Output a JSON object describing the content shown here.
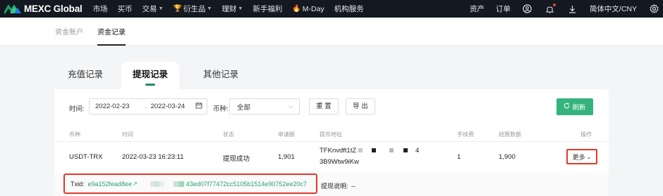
{
  "app": {
    "brand": "MEXC Global"
  },
  "topnav": {
    "items": [
      {
        "label": "市场",
        "caret": false
      },
      {
        "label": "买币",
        "caret": false
      },
      {
        "label": "交易",
        "caret": true
      },
      {
        "label": "衍生品",
        "caret": true
      },
      {
        "label": "理财",
        "caret": true
      },
      {
        "label": "新手福利",
        "caret": false
      },
      {
        "label": "M-Day",
        "caret": false
      },
      {
        "label": "机构服务",
        "caret": false
      }
    ],
    "assets": "资产",
    "orders": "订单",
    "language": "简体中文/CNY",
    "icons": [
      "trophy-icon",
      "flame-icon",
      "user-icon",
      "bell-icon",
      "download-icon",
      "gear-icon"
    ]
  },
  "subnav": {
    "tabs": [
      "资金账户",
      "资金记录"
    ],
    "active": 1
  },
  "tabs": {
    "items": [
      "充值记录",
      "提现记录",
      "其他记录"
    ],
    "active": 1
  },
  "filters": {
    "time_label": "时间:",
    "start_date": "2022-02-23",
    "end_date": "2022-03-24",
    "coin_label": "币种:",
    "coin_value": "全部",
    "reset": "重 置",
    "export": "导 出",
    "refresh": "刷新"
  },
  "table": {
    "columns": [
      "币种",
      "时间",
      "状态",
      "申请额",
      "提币地址",
      "手续费",
      "结算数额",
      "操作"
    ],
    "rows": [
      {
        "coin": "USDT-TRX",
        "time": "2022-03-23 16:23:11",
        "status": "提现成功",
        "amount": "1,901",
        "address_line1_start": "TFKnvdft1tZ",
        "address_line1_end": "4",
        "address_line2": "3B9Wtw9iKw",
        "fee": "1",
        "settled": "1,900",
        "action": "更多"
      }
    ],
    "txid_label": "Txid:",
    "txid_start": "e9a152fead8ee",
    "txid_end": "43ed07f77472cc5105b1514e90752ee20c7",
    "note_label": "提现说明:",
    "note_value": "--"
  },
  "colors": {
    "accent": "#34b37c",
    "highlight": "#e0392b",
    "nav_bg": "#131821"
  }
}
